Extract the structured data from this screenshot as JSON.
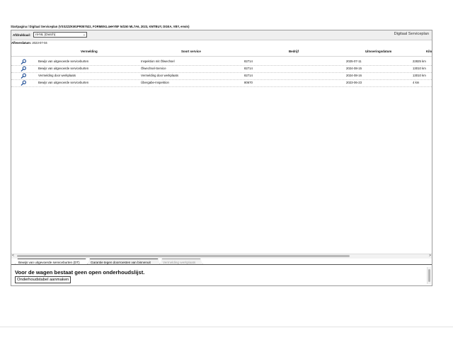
{
  "breadcrumb": "Startpagina / Digitaal Serviceplan (VSSZZZKM1PR057522, FORMEN1.4eHYBF 5d150 ML7A6, 2023, KMTBUY, DGEA, VBY, erwin)",
  "header": {
    "plan_title": "Digitaal Serviceplan",
    "language_label": "Afdrukkaal:",
    "language_value": "nl-NL (Dutch)",
    "delivery_label": "Afleverdatum:",
    "delivery_value": "2023-07-04"
  },
  "table": {
    "columns": [
      "Vermelding",
      "Soort service",
      "Bedrijf",
      "Uitvoeringsdatum",
      "Kilo"
    ],
    "rows": [
      {
        "vermelding": "Bewijs van uitgevoerde serviceburten",
        "soort": "Inspektion mit Ölwechsel",
        "bedrijf": "82714",
        "datum": "2025-07-11",
        "km": "22825 km"
      },
      {
        "vermelding": "Bewijs van uitgevoerde serviceburten",
        "soort": "Ölwechsel-Service",
        "bedrijf": "82714",
        "datum": "2024-08-15",
        "km": "13010 km"
      },
      {
        "vermelding": "Vermelding door werkplaats",
        "soort": "Vermelding door werkplaats",
        "bedrijf": "82714",
        "datum": "2024-08-16",
        "km": "13010 km"
      },
      {
        "vermelding": "Bewijs van uitgevoerde serviceburten",
        "soort": "Übergabe-Inspektion",
        "bedrijf": "80670",
        "datum": "2023-06-23",
        "km": "4 km"
      }
    ]
  },
  "tabs": [
    {
      "label": "Bewijs van uitgevoerde serviceburten (DT)",
      "state": "active"
    },
    {
      "label": "Garantie tegen doorroesten van binnenuit",
      "state": "normal"
    },
    {
      "label": "Vermelding werkplaats",
      "state": "disabled"
    }
  ],
  "panel": {
    "notice": "Voor de wagen bestaat geen open onderhoudslijst.",
    "create_button": "Onderhoudstabel aanmaken"
  },
  "scroll": {
    "left_arrow": "<",
    "right_arrow": ">"
  },
  "icons": {
    "row_action": "magnifier-icon",
    "dropdown": "chevron-down-icon"
  },
  "colors": {
    "icon_blue": "#1f4e96",
    "border": "#9a9a9a",
    "tab_border": "#555555"
  }
}
